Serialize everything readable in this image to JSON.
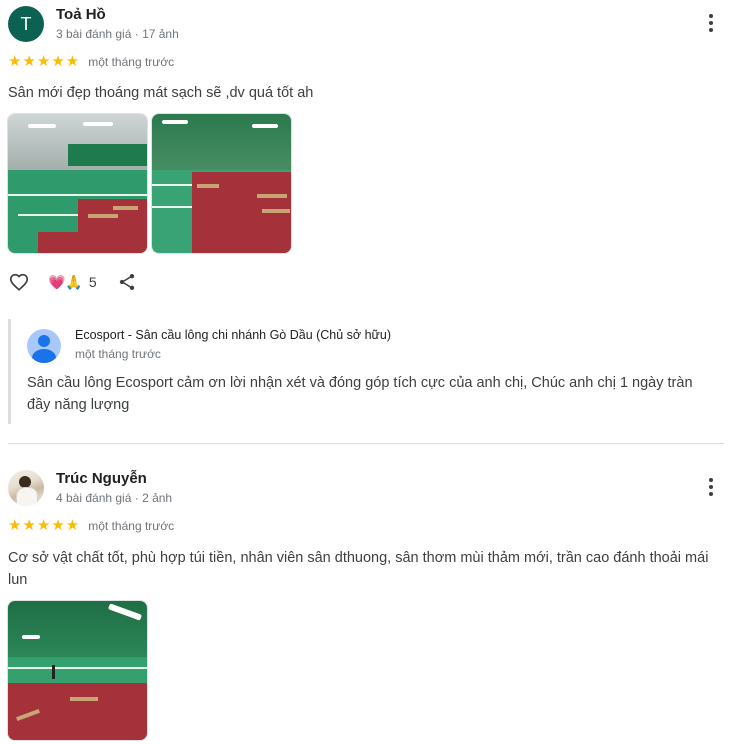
{
  "review1": {
    "avatar_letter": "T",
    "name": "Toả Hồ",
    "meta": "3 bài đánh giá · 17 ảnh",
    "stars": "★★★★★",
    "rating": 5,
    "time": "một tháng trước",
    "text": "Sân mới đẹp thoáng mát sạch sẽ ,dv quá tốt ah",
    "reaction_emojis": "💗🙏",
    "reaction_count": "5"
  },
  "reply": {
    "owner_name": "Ecosport - Sân cầu lông chi nhánh Gò Dầu (Chủ sở hữu)",
    "time": "một tháng trước",
    "text": "Sân cầu lông Ecosport cảm ơn lời nhận xét và đóng góp tích cực của anh chị, Chúc anh chị 1 ngày tràn đầy năng lượng"
  },
  "review2": {
    "name": "Trúc Nguyễn",
    "meta": "4 bài đánh giá · 2 ảnh",
    "stars": "★★★★★",
    "rating": 5,
    "time": "một tháng trước",
    "text": "Cơ sở vật chất tốt, phù hợp túi tiền, nhân viên sân dthuong, sân thơm mùi thảm mới, trần cao đánh thoải mái lun"
  },
  "icons": {
    "more": "more-vert-icon",
    "like": "heart-outline-icon",
    "share": "share-icon",
    "owner_avatar": "person-icon"
  },
  "colors": {
    "star": "#fbbc04",
    "avatar_bg": "#0b6152",
    "reply_border": "#dadce0"
  }
}
